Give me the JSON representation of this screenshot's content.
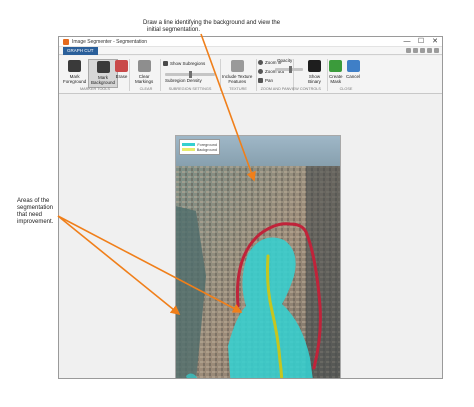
{
  "annotations": {
    "top_line1": "Draw a line identifying the background and view the",
    "top_line2": "initial segmentation.",
    "left_line1": "Areas of the",
    "left_line2": "segmentation",
    "left_line3": "that need",
    "left_line4": "improvement."
  },
  "window": {
    "title": "Image Segmenter - Segmentation",
    "minimize": "—",
    "maximize": "☐",
    "close": "✕"
  },
  "tab": {
    "label": "GRAPH CUT"
  },
  "toolstrip": {
    "mark_foreground": {
      "line1": "Mark",
      "line2": "Foreground"
    },
    "mark_background": {
      "line1": "Mark",
      "line2": "Background"
    },
    "erase": "Erase",
    "clear_markings": {
      "line1": "Clear",
      "line2": "Markings"
    },
    "show_subregions": "Show Subregions",
    "subregion_density": "Subregion Density",
    "include_texture": {
      "line1": "Include Texture",
      "line2": "Features"
    },
    "zoom_in": "Zoom in",
    "zoom_out": "Zoom out",
    "pan": "Pan",
    "opacity": "Opacity",
    "show_binary": {
      "line1": "Show",
      "line2": "Binary"
    },
    "create_mask": {
      "line1": "Create",
      "line2": "Mask"
    },
    "cancel": "Cancel",
    "sections": {
      "marker_tools": "MARKER TOOLS",
      "clear": "CLEAR",
      "subregion_settings": "SUBREGION SETTINGS",
      "texture": "TEXTURE",
      "zoom_and_pan": "ZOOM AND PAN",
      "view_controls": "VIEW CONTROLS",
      "close": "CLOSE"
    }
  },
  "legend": {
    "foreground": "Foreground",
    "background": "Background"
  },
  "colors": {
    "annotation_arrow": "#f07f1a",
    "segmentation_overlay": "#35d0d0",
    "background_stroke": "#c0233a",
    "foreground_stroke": "#c6c61e",
    "tab_active": "#2a5f9a"
  },
  "icons": {
    "mark_foreground": "pencil-plus-icon",
    "mark_background": "pencil-minus-icon",
    "erase": "eraser-icon",
    "clear_markings": "trash-icon",
    "include_texture": "texture-icon",
    "show_binary": "binary-image-icon",
    "create_mask": "checkmark-icon",
    "cancel": "cancel-x-icon"
  },
  "settings": {
    "show_subregions": true,
    "include_texture_features": false
  }
}
